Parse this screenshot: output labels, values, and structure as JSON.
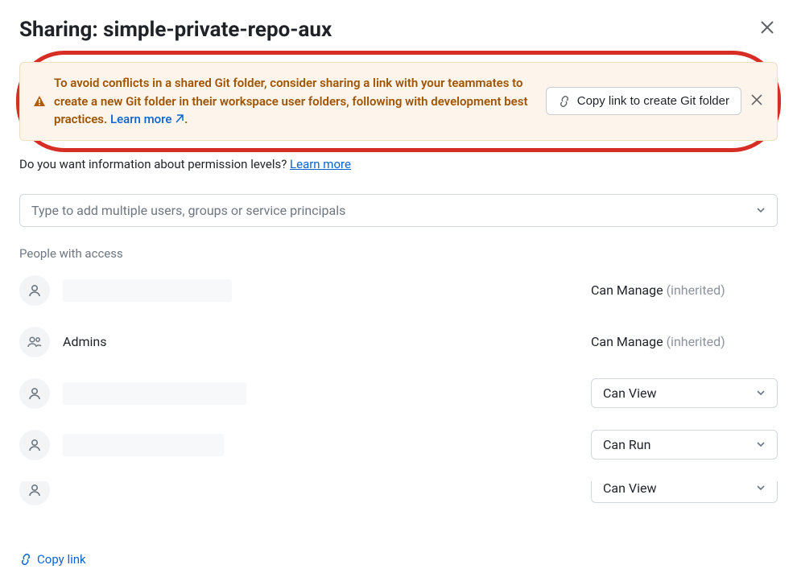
{
  "header": {
    "title": "Sharing: simple-private-repo-aux"
  },
  "alert": {
    "text": "To avoid conflicts in a shared Git folder, consider sharing a link with your teammates to create a new Git folder in their workspace user folders, following with development best practices.",
    "learn_more": "Learn more",
    "period": ".",
    "button": "Copy link to create Git folder"
  },
  "info": {
    "text": "Do you want information about permission levels? ",
    "learn_more": "Learn more"
  },
  "add_input": {
    "placeholder": "Type to add multiple users, groups or service principals"
  },
  "section_label": "People with access",
  "access": [
    {
      "type": "user",
      "name": "",
      "redacted": true,
      "permission": "Can Manage",
      "inherited": "(inherited)",
      "select": false
    },
    {
      "type": "group",
      "name": "Admins",
      "redacted": false,
      "permission": "Can Manage",
      "inherited": "(inherited)",
      "select": false
    },
    {
      "type": "user",
      "name": "",
      "redacted": true,
      "permission": "Can View",
      "inherited": "",
      "select": true
    },
    {
      "type": "user",
      "name": "",
      "redacted": true,
      "permission": "Can Run",
      "inherited": "",
      "select": true
    },
    {
      "type": "user",
      "name": "",
      "redacted": true,
      "permission": "Can View",
      "inherited": "",
      "select": true
    }
  ],
  "footer": {
    "copy_link": "Copy link"
  }
}
